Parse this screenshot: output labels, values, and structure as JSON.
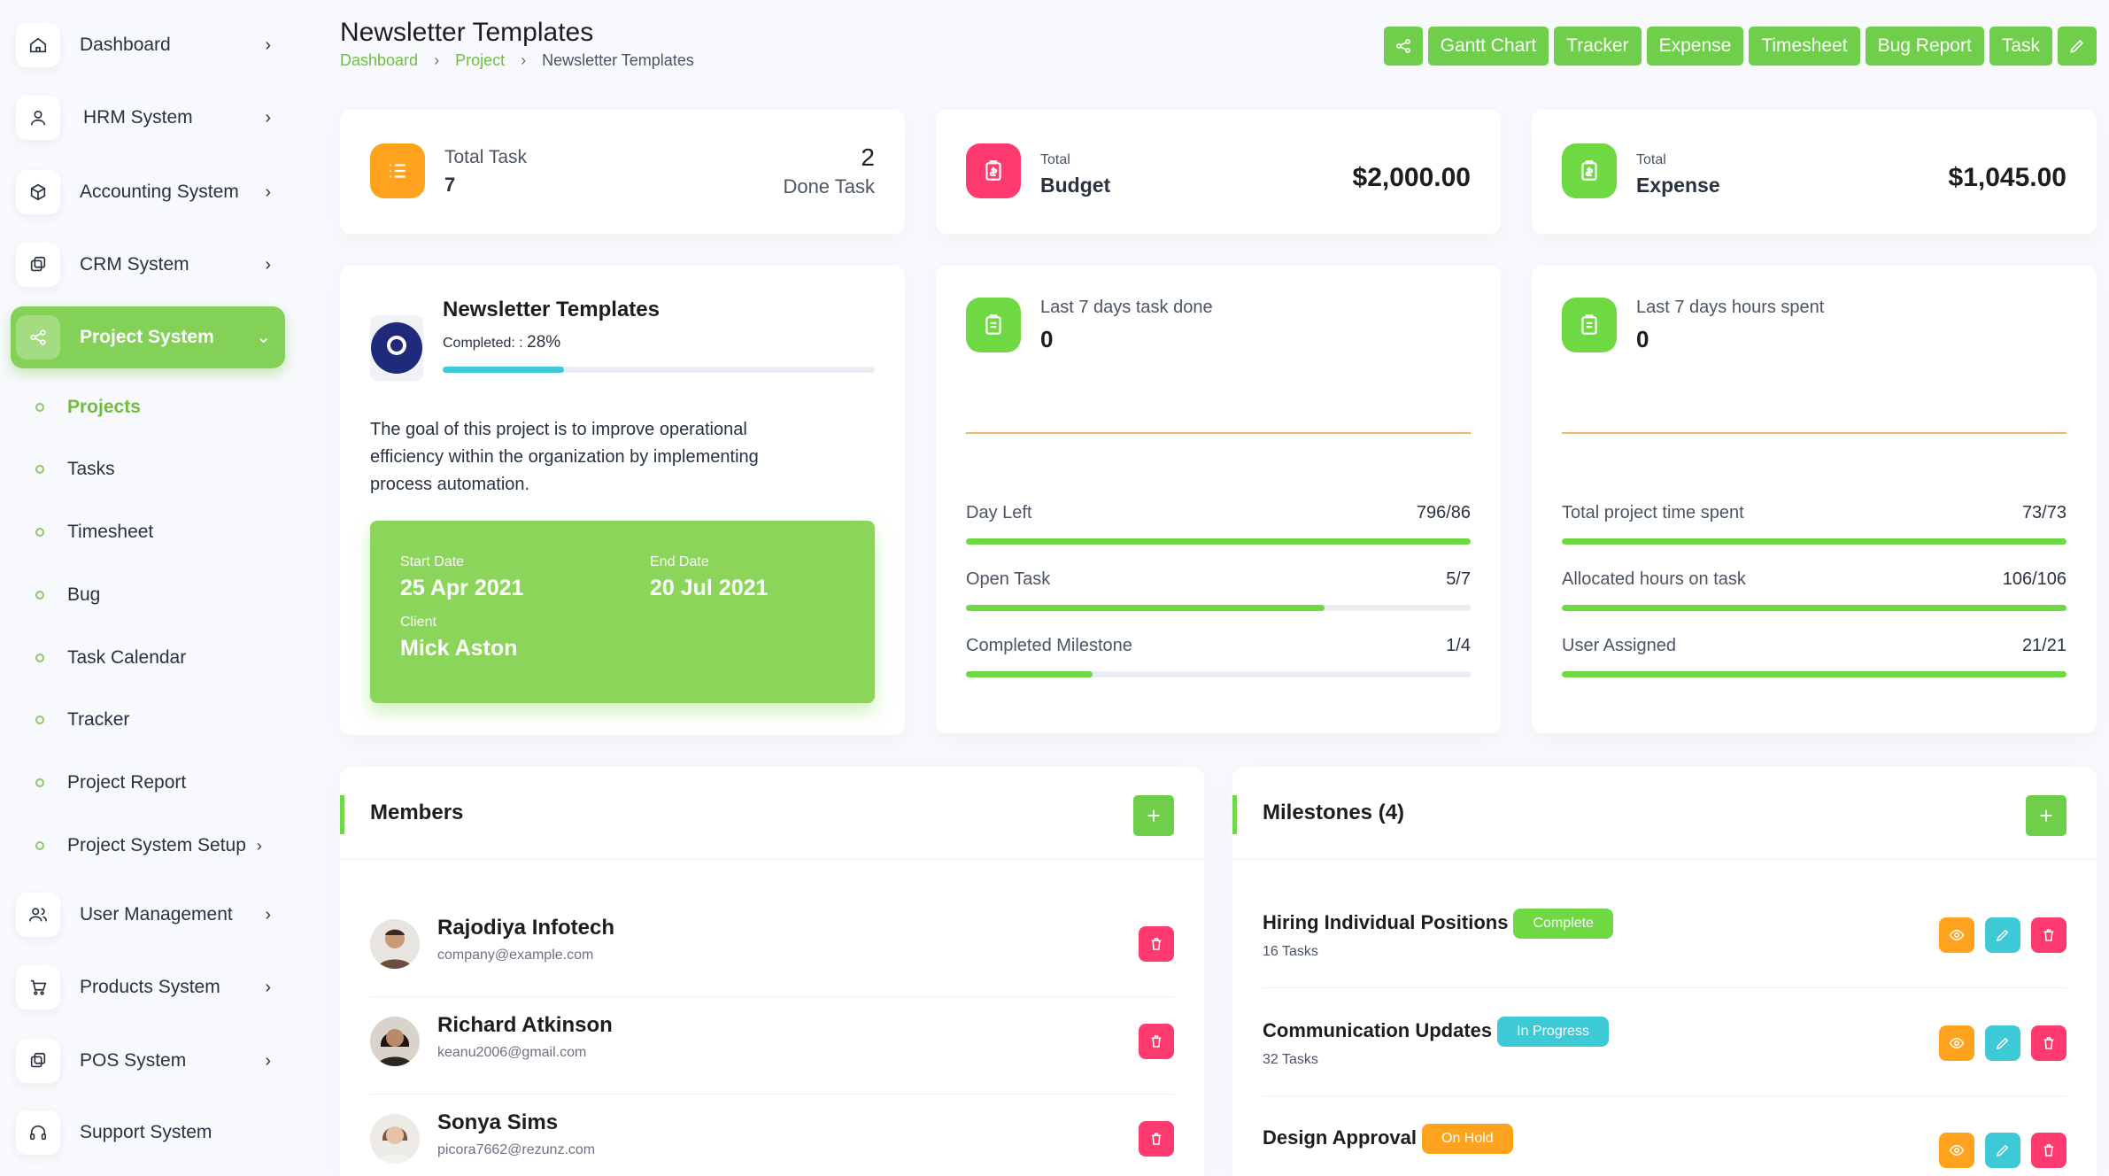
{
  "sidebar": {
    "items": [
      {
        "label": "Dashboard",
        "icon": "home-icon"
      },
      {
        "label": "HRM System",
        "icon": "user-icon"
      },
      {
        "label": "Accounting System",
        "icon": "box-icon"
      },
      {
        "label": "CRM System",
        "icon": "layers-icon"
      },
      {
        "label": "Project System",
        "icon": "share-icon"
      },
      {
        "label": "User Management",
        "icon": "users-icon"
      },
      {
        "label": "Products System",
        "icon": "cart-icon"
      },
      {
        "label": "POS System",
        "icon": "layers-icon"
      },
      {
        "label": "Support System",
        "icon": "headphones-icon"
      }
    ],
    "sub_items": [
      "Projects",
      "Tasks",
      "Timesheet",
      "Bug",
      "Task Calendar",
      "Tracker",
      "Project Report",
      "Project System Setup"
    ]
  },
  "header": {
    "title": "Newsletter Templates",
    "breadcrumb": [
      "Dashboard",
      "Project",
      "Newsletter Templates"
    ],
    "toolbar": [
      "Gantt Chart",
      "Tracker",
      "Expense",
      "Timesheet",
      "Bug Report",
      "Task"
    ]
  },
  "stats": {
    "total_task_label": "Total Task",
    "total_task_value": "7",
    "done_task_value": "2",
    "done_task_label": "Done Task",
    "budget_small": "Total",
    "budget_label": "Budget",
    "budget_amount": "$2,000.00",
    "expense_small": "Total",
    "expense_label": "Expense",
    "expense_amount": "$1,045.00"
  },
  "project": {
    "name": "Newsletter Templates",
    "completed_label": "Completed: :",
    "completed_value": "28%",
    "completed_fraction": 0.28,
    "description": "The goal of this project is to improve operational efficiency within the organization by implementing process automation.",
    "start_label": "Start Date",
    "start_value": "25 Apr 2021",
    "end_label": "End Date",
    "end_value": "20 Jul 2021",
    "client_label": "Client",
    "client_value": "Mick Aston"
  },
  "task_panel": {
    "title": "Last 7 days task done",
    "value": "0",
    "rows": [
      {
        "label": "Day Left",
        "value": "796/86",
        "fraction": 1.0
      },
      {
        "label": "Open Task",
        "value": "5/7",
        "fraction": 0.71
      },
      {
        "label": "Completed Milestone",
        "value": "1/4",
        "fraction": 0.25
      }
    ]
  },
  "hours_panel": {
    "title": "Last 7 days hours spent",
    "value": "0",
    "rows": [
      {
        "label": "Total project time spent",
        "value": "73/73",
        "fraction": 1.0
      },
      {
        "label": "Allocated hours on task",
        "value": "106/106",
        "fraction": 1.0
      },
      {
        "label": "User Assigned",
        "value": "21/21",
        "fraction": 1.0
      }
    ]
  },
  "members": {
    "title": "Members",
    "add": "+",
    "list": [
      {
        "name": "Rajodiya Infotech",
        "email": "company@example.com"
      },
      {
        "name": "Richard Atkinson",
        "email": "keanu2006@gmail.com"
      },
      {
        "name": "Sonya Sims",
        "email": "picora7662@rezunz.com"
      }
    ]
  },
  "milestones": {
    "title": "Milestones (4)",
    "add": "+",
    "list": [
      {
        "name": "Hiring Individual Positions",
        "status": "Complete",
        "tasks": "16 Tasks"
      },
      {
        "name": "Communication Updates",
        "status": "In Progress",
        "tasks": "32 Tasks"
      },
      {
        "name": "Design Approval",
        "status": "On Hold",
        "tasks": ""
      }
    ]
  },
  "colors": {
    "accent": "#6fd943",
    "orange": "#ffa21d",
    "pink": "#ff3a6e",
    "teal": "#3ec9d6"
  }
}
